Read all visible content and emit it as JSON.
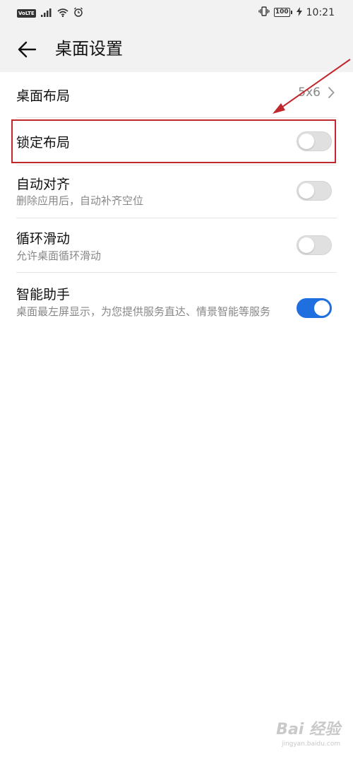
{
  "status_bar": {
    "volte": "VoLTE",
    "battery": "100",
    "time": "10:21"
  },
  "app_bar": {
    "title": "桌面设置"
  },
  "settings": {
    "layout": {
      "title": "桌面布局",
      "value": "5x6"
    },
    "lock_layout": {
      "title": "锁定布局",
      "enabled": false
    },
    "auto_align": {
      "title": "自动对齐",
      "subtitle": "删除应用后，自动补齐空位",
      "enabled": false
    },
    "loop_scroll": {
      "title": "循环滑动",
      "subtitle": "允许桌面循环滑动",
      "enabled": false
    },
    "smart_assistant": {
      "title": "智能助手",
      "subtitle": "桌面最左屏显示，为您提供服务直达、情景智能等服务",
      "enabled": true
    }
  },
  "annotation": {
    "color": "#c0282d"
  },
  "watermark": {
    "logo": "Bai 经验",
    "url": "jingyan.baidu.com"
  },
  "colors": {
    "toggle_on": "#1f6fe0",
    "toggle_off": "#e0e0e0",
    "header_bg": "#f2f2f2"
  }
}
